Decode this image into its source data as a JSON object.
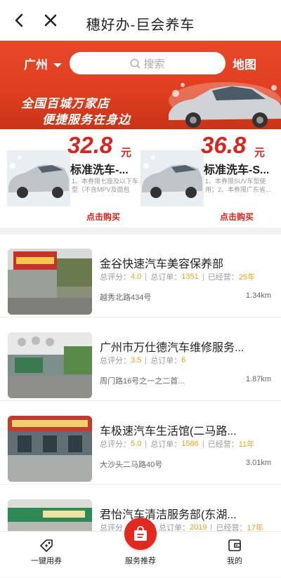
{
  "header": {
    "title": "穗好办-巨会养车",
    "back_icon": "chevron-left-icon",
    "close_icon": "close-icon"
  },
  "banner": {
    "city": "广州",
    "search_placeholder": "搜索",
    "map_label": "地图",
    "slogan_line1": "全国百城万家店",
    "slogan_line2": "便捷服务在身边",
    "accent": "#e0401f"
  },
  "coupons": [
    {
      "price": "32.8",
      "unit": "元",
      "name": "标准洗车-...",
      "desc": "1、本券限七座及以下车型（不含MPV及面包车...",
      "buy": "点击购买"
    },
    {
      "price": "36.8",
      "unit": "元",
      "name": "标准洗车-S...",
      "desc": "1、本券限SUV车型使用；2、本券限广东省...",
      "buy": "点击购买"
    }
  ],
  "shops": [
    {
      "name": "金谷快速汽车美容保养部",
      "score_label": "总评分：",
      "score": "4.0",
      "orders_label": "总订单：",
      "orders": "1351",
      "years_label": "已经营：",
      "years": "25年",
      "address": "越秀北路434号",
      "distance": "1.34km"
    },
    {
      "name": "广州市万仕德汽车维修服务...",
      "score_label": "总评分：",
      "score": "3.5",
      "orders_label": "总订单：",
      "orders": "6",
      "years_label": "",
      "years": "",
      "address": "周门路16号之一之二首...",
      "distance": "1.87km"
    },
    {
      "name": "车极速汽车生活馆(二马路...",
      "score_label": "总评分：",
      "score": "5.0",
      "orders_label": "总订单：",
      "orders": "1586",
      "years_label": "已经营：",
      "years": "11年",
      "address": "大沙头二马路40号",
      "distance": "3.01km"
    },
    {
      "name": "君怡汽车清洁服务部(东湖...",
      "score_label": "总评分",
      "score": "",
      "orders_label": "总订单：",
      "orders": "2019",
      "years_label": "已经营：",
      "years": "17年",
      "address": "",
      "distance": ""
    }
  ],
  "tabs": [
    {
      "label": "一键用券",
      "icon": "coupon-tag-icon"
    },
    {
      "label": "服务推荐",
      "icon": "shopping-bag-icon"
    },
    {
      "label": "我的",
      "icon": "wallet-icon"
    }
  ]
}
